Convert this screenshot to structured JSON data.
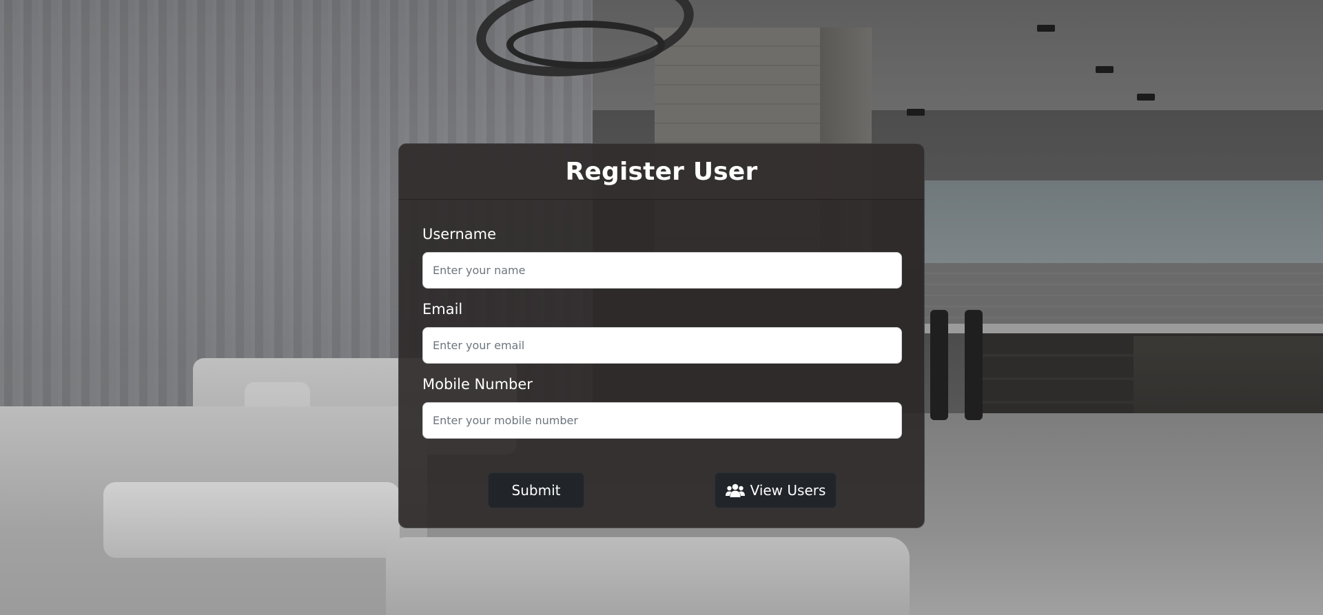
{
  "form": {
    "title": "Register User",
    "fields": [
      {
        "label": "Username",
        "placeholder": "Enter your name",
        "value": ""
      },
      {
        "label": "Email",
        "placeholder": "Enter your email",
        "value": ""
      },
      {
        "label": "Mobile Number",
        "placeholder": "Enter your mobile number",
        "value": ""
      }
    ],
    "submit_label": "Submit",
    "view_users_label": "View Users",
    "view_users_icon": "users-icon"
  },
  "colors": {
    "card_bg": "#2a2626",
    "button_bg": "#212529",
    "text": "#ffffff"
  }
}
